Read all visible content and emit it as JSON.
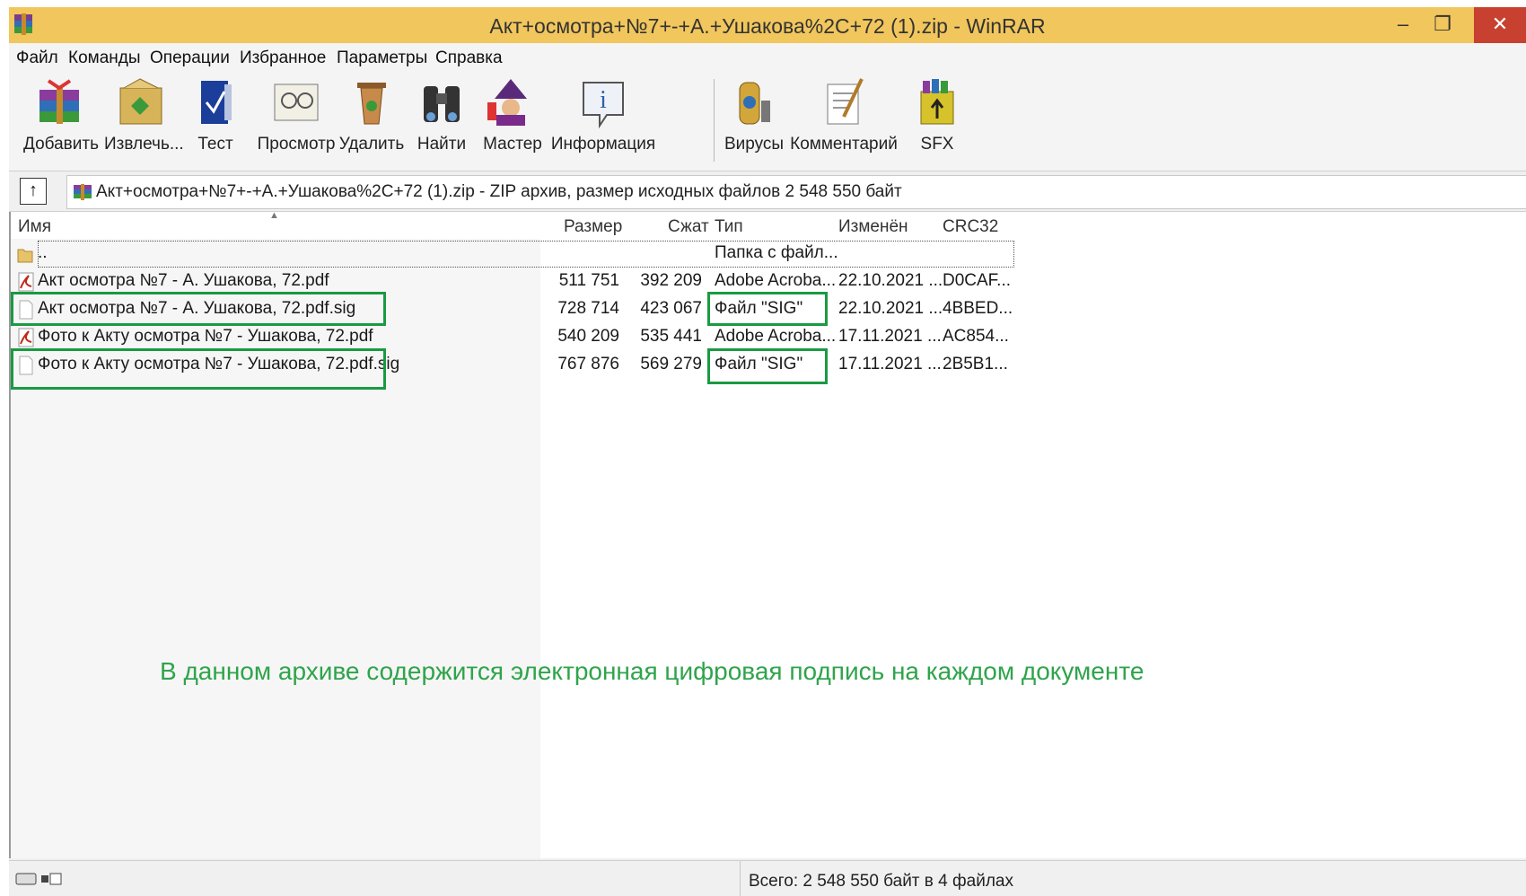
{
  "window": {
    "title": "Акт+осмотра+№7+-+А.+Ушакова%2C+72 (1).zip - WinRAR",
    "minimize": "–",
    "maximize": "❐",
    "close": "✕"
  },
  "menu": [
    {
      "label": "Файл"
    },
    {
      "label": "Команды"
    },
    {
      "label": "Операции"
    },
    {
      "label": "Избранное"
    },
    {
      "label": "Параметры"
    },
    {
      "label": "Справка"
    }
  ],
  "toolbar": [
    {
      "label": "Добавить",
      "icon": "add-archive-icon"
    },
    {
      "label": "Извлечь...",
      "icon": "extract-icon"
    },
    {
      "label": "Тест",
      "icon": "test-icon"
    },
    {
      "label": "Просмотр",
      "icon": "view-icon"
    },
    {
      "label": "Удалить",
      "icon": "delete-icon"
    },
    {
      "label": "Найти",
      "icon": "find-icon"
    },
    {
      "label": "Мастер",
      "icon": "wizard-icon"
    },
    {
      "label": "Информация",
      "icon": "info-icon"
    },
    {
      "label": "Вирусы",
      "icon": "virus-scan-icon"
    },
    {
      "label": "Комментарий",
      "icon": "comment-icon"
    },
    {
      "label": "SFX",
      "icon": "sfx-icon"
    }
  ],
  "address": {
    "text": "Акт+осмотра+№7+-+А.+Ушакова%2C+72 (1).zip - ZIP архив, размер исходных файлов 2 548 550 байт"
  },
  "columns": {
    "name": "Имя",
    "size": "Размер",
    "packed": "Сжат",
    "type": "Тип",
    "modified": "Изменён",
    "crc": "CRC32"
  },
  "files": [
    {
      "name": "..",
      "size": "",
      "packed": "",
      "type": "Папка с файл...",
      "modified": "",
      "crc": "",
      "icon": "folder-icon"
    },
    {
      "name": "Акт осмотра №7 - А. Ушакова, 72.pdf",
      "size": "511 751",
      "packed": "392 209",
      "type": "Adobe Acroba...",
      "modified": "22.10.2021 ...",
      "crc": "D0CAF...",
      "icon": "pdf-icon"
    },
    {
      "name": "Акт осмотра №7 - А. Ушакова, 72.pdf.sig",
      "size": "728 714",
      "packed": "423 067",
      "type": "Файл \"SIG\"",
      "modified": "22.10.2021 ...",
      "crc": "4BBED...",
      "icon": "file-icon"
    },
    {
      "name": "Фото к Акту осмотра №7 - Ушакова, 72.pdf",
      "size": "540 209",
      "packed": "535 441",
      "type": "Adobe Acroba...",
      "modified": "17.11.2021 ...",
      "crc": "AC854...",
      "icon": "pdf-icon"
    },
    {
      "name": "Фото к Акту осмотра №7 - Ушакова, 72.pdf.sig",
      "size": "767 876",
      "packed": "569 279",
      "type": "Файл \"SIG\"",
      "modified": "17.11.2021 ...",
      "crc": "2B5B1...",
      "icon": "file-icon"
    }
  ],
  "annotation": {
    "text": "В данном архиве содержится электронная цифровая подпись на каждом документе",
    "color": "#2fa44b"
  },
  "highlight_color": "#1a9a42",
  "status": {
    "text": "Всего: 2 548 550 байт в 4 файлах"
  }
}
